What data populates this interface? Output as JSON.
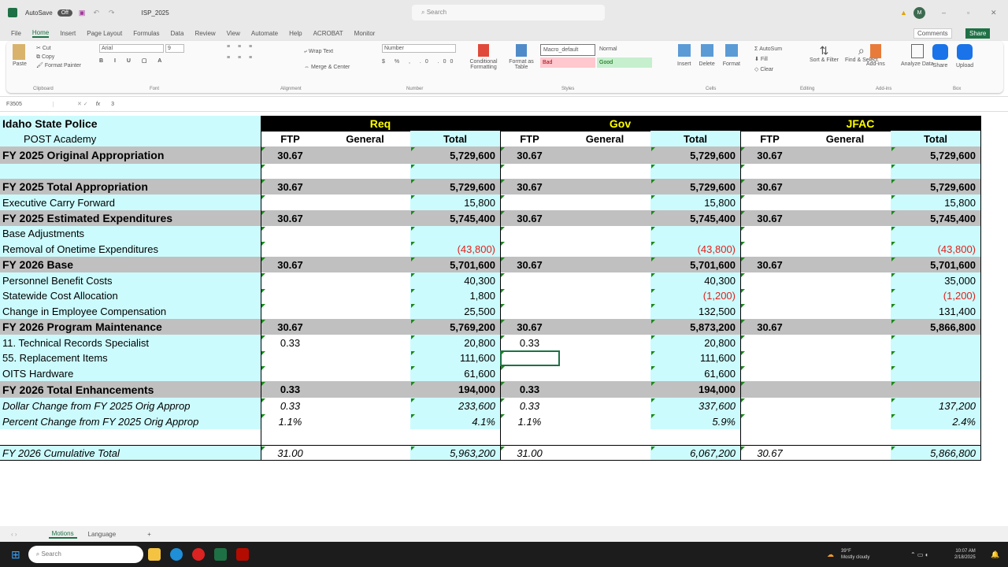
{
  "titlebar": {
    "autosave": "AutoSave",
    "autosave_state": "Off",
    "filename": "ISP_2025",
    "search_placeholder": "Search",
    "avatar": "M"
  },
  "menu": [
    "File",
    "Home",
    "Insert",
    "Page Layout",
    "Formulas",
    "Data",
    "Review",
    "View",
    "Automate",
    "Help",
    "ACROBAT",
    "Monitor"
  ],
  "menu_right": {
    "comments": "Comments",
    "share": "Share"
  },
  "ribbon": {
    "paste": "Paste",
    "cut": "Cut",
    "copy": "Copy",
    "format_painter": "Format Painter",
    "clipboard": "Clipboard",
    "font_name": "Arial",
    "font_size": "9",
    "font": "Font",
    "wrap_text": "Wrap Text",
    "merge_center": "Merge & Center",
    "alignment": "Alignment",
    "number_format": "Number",
    "number": "Number",
    "conditional_formatting": "Conditional Formatting",
    "format_as_table": "Format as Table",
    "style_cells": [
      "Macro_default",
      "Normal",
      "Bad",
      "Good"
    ],
    "styles": "Styles",
    "insert": "Insert",
    "delete": "Delete",
    "format": "Format",
    "cells": "Cells",
    "autosum": "AutoSum",
    "fill": "Fill",
    "clear": "Clear",
    "sort_filter": "Sort & Filter",
    "find_select": "Find & Select",
    "editing": "Editing",
    "addins": "Add-ins",
    "analyze_data": "Analyze Data",
    "addins_group": "Add-ins",
    "share_box": "Share",
    "upload": "Upload",
    "box": "Box"
  },
  "formula_bar": {
    "name_box": "F3505",
    "fx": "fx",
    "value": "3"
  },
  "sheet": {
    "header": {
      "agency": "Idaho State Police",
      "program": "POST Academy",
      "groups": [
        "Req",
        "Gov",
        "JFAC"
      ],
      "cols": [
        "FTP",
        "General",
        "Total"
      ]
    },
    "rows": [
      {
        "label": "FY 2025 Original Appropriation",
        "style": "grey",
        "v": [
          "30.67",
          "",
          "5,729,600",
          "30.67",
          "",
          "5,729,600",
          "30.67",
          "",
          "5,729,600"
        ]
      },
      {
        "label": "",
        "style": "blank",
        "v": [
          "",
          "",
          "",
          "",
          "",
          "",
          "",
          "",
          ""
        ]
      },
      {
        "label": "FY 2025 Total Appropriation",
        "style": "grey",
        "v": [
          "30.67",
          "",
          "5,729,600",
          "30.67",
          "",
          "5,729,600",
          "30.67",
          "",
          "5,729,600"
        ]
      },
      {
        "label": "Executive Carry Forward",
        "style": "",
        "v": [
          "",
          "",
          "15,800",
          "",
          "",
          "15,800",
          "",
          "",
          "15,800"
        ]
      },
      {
        "label": "FY 2025 Estimated Expenditures",
        "style": "grey",
        "v": [
          "30.67",
          "",
          "5,745,400",
          "30.67",
          "",
          "5,745,400",
          "30.67",
          "",
          "5,745,400"
        ]
      },
      {
        "label": "Base Adjustments",
        "style": "",
        "v": [
          "",
          "",
          "",
          "",
          "",
          "",
          "",
          "",
          ""
        ]
      },
      {
        "label": "Removal of Onetime Expenditures",
        "style": "",
        "v": [
          "",
          "",
          "(43,800)",
          "",
          "",
          "(43,800)",
          "",
          "",
          "(43,800)"
        ]
      },
      {
        "label": "FY 2026 Base",
        "style": "grey",
        "v": [
          "30.67",
          "",
          "5,701,600",
          "30.67",
          "",
          "5,701,600",
          "30.67",
          "",
          "5,701,600"
        ]
      },
      {
        "label": "Personnel Benefit Costs",
        "style": "",
        "v": [
          "",
          "",
          "40,300",
          "",
          "",
          "40,300",
          "",
          "",
          "35,000"
        ]
      },
      {
        "label": "Statewide Cost Allocation",
        "style": "",
        "v": [
          "",
          "",
          "1,800",
          "",
          "",
          "(1,200)",
          "",
          "",
          "(1,200)"
        ]
      },
      {
        "label": "Change in Employee Compensation",
        "style": "",
        "v": [
          "",
          "",
          "25,500",
          "",
          "",
          "132,500",
          "",
          "",
          "131,400"
        ]
      },
      {
        "label": "FY 2026 Program Maintenance",
        "style": "grey",
        "v": [
          "30.67",
          "",
          "5,769,200",
          "30.67",
          "",
          "5,873,200",
          "30.67",
          "",
          "5,866,800"
        ]
      },
      {
        "label": "11. Technical Records Specialist",
        "style": "",
        "v": [
          "0.33",
          "",
          "20,800",
          "0.33",
          "",
          "20,800",
          "",
          "",
          ""
        ]
      },
      {
        "label": "55. Replacement Items",
        "style": "",
        "v": [
          "",
          "",
          "111,600",
          "",
          "",
          "111,600",
          "",
          "",
          ""
        ]
      },
      {
        "label": "OITS Hardware",
        "style": "",
        "v": [
          "",
          "",
          "61,600",
          "",
          "",
          "61,600",
          "",
          "",
          ""
        ]
      },
      {
        "label": "FY 2026 Total Enhancements",
        "style": "grey",
        "v": [
          "0.33",
          "",
          "194,000",
          "0.33",
          "",
          "194,000",
          "",
          "",
          ""
        ]
      },
      {
        "label": "Dollar Change from FY 2025 Orig Approp",
        "style": "ital",
        "v": [
          "0.33",
          "",
          "233,600",
          "0.33",
          "",
          "337,600",
          "",
          "",
          "137,200"
        ]
      },
      {
        "label": "Percent Change from FY 2025 Orig Approp",
        "style": "ital",
        "v": [
          "1.1%",
          "",
          "4.1%",
          "1.1%",
          "",
          "5.9%",
          "",
          "",
          "2.4%"
        ]
      },
      {
        "label": "",
        "style": "gap",
        "v": [
          "",
          "",
          "",
          "",
          "",
          "",
          "",
          "",
          ""
        ]
      },
      {
        "label": "FY 2026 Cumulative Total",
        "style": "ital",
        "v": [
          "31.00",
          "",
          "5,963,200",
          "31.00",
          "",
          "6,067,200",
          "30.67",
          "",
          "5,866,800"
        ]
      }
    ]
  },
  "sheet_tabs": [
    "Motions",
    "Language"
  ],
  "taskbar": {
    "search": "Search",
    "weather": "39°F",
    "weather_desc": "Mostly cloudy",
    "time": "10:07 AM",
    "date": "2/18/2025"
  }
}
